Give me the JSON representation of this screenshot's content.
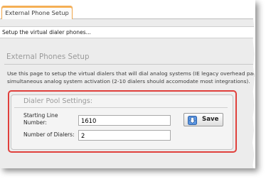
{
  "tab": {
    "label": "External Phone Setup"
  },
  "subheader": {
    "text": "Setup the virtual dialer phones..."
  },
  "panel": {
    "title": "External Phones Setup",
    "description_line1": "Use this page to setup the virtual dialers that will dial analog systems (IE legacy overhead pag",
    "description_line2": "simultaneous analog system activation (2-10 dialers should accomodate most integrations)."
  },
  "dialer_pool": {
    "title": "Dialer Pool Settings:",
    "starting_line_label_1": "Starting Line",
    "starting_line_label_2": "Number:",
    "starting_line_value": "1610",
    "number_of_dialers_label": "Number of Dialers:",
    "number_of_dialers_value": "2",
    "save_label": "Save",
    "save_icon": "save-arrow-icon"
  },
  "colors": {
    "tab_accent": "#f0a64a",
    "highlight": "#e0403c",
    "save_icon": "#3d7fd6"
  }
}
